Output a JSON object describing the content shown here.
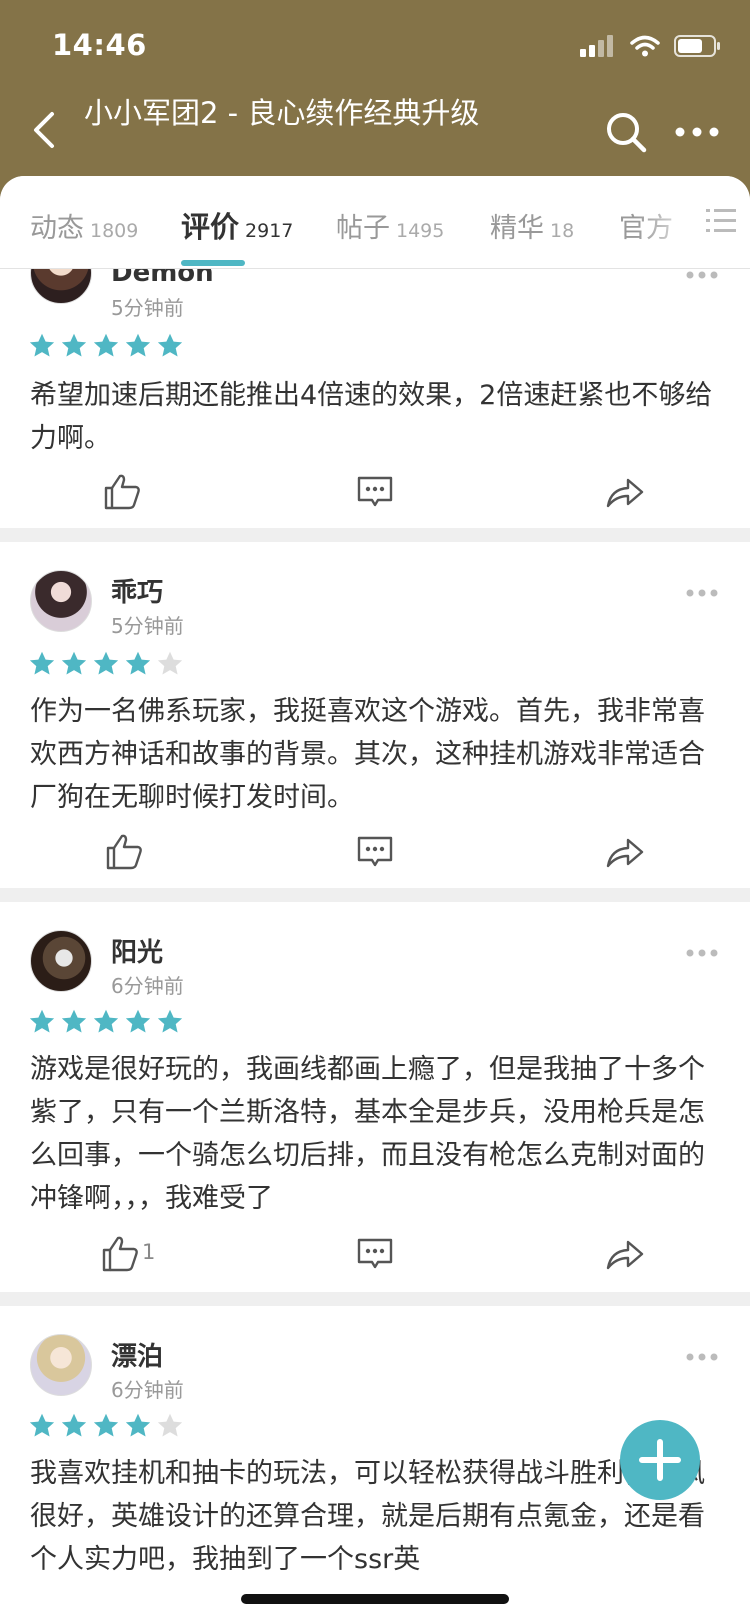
{
  "status_bar": {
    "time": "14:46"
  },
  "header": {
    "title": "小小军团2 - 良心续作经典升级"
  },
  "tabs": [
    {
      "label": "动态",
      "count": "1809"
    },
    {
      "label": "评价",
      "count": "2917"
    },
    {
      "label": "帖子",
      "count": "1495"
    },
    {
      "label": "精华",
      "count": "18"
    },
    {
      "label": "官方",
      "count": ""
    }
  ],
  "reviews": [
    {
      "user": "Demon",
      "time": "5分钟前",
      "rating": 5,
      "text": "希望加速后期还能推出4倍速的效果，2倍速赶紧也不够给力啊。",
      "likes": ""
    },
    {
      "user": "乖巧",
      "time": "5分钟前",
      "rating": 4,
      "text": "作为一名佛系玩家，我挺喜欢这个游戏。首先，我非常喜欢西方神话和故事的背景。其次，这种挂机游戏非常适合厂狗在无聊时候打发时间。",
      "likes": ""
    },
    {
      "user": "阳光",
      "time": "6分钟前",
      "rating": 5,
      "text": "游戏是很好玩的，我画线都画上瘾了，但是我抽了十多个紫了，只有一个兰斯洛特，基本全是步兵，没用枪兵是怎么回事，一个骑怎么切后排，而且没有枪怎么克制对面的冲锋啊，，，我难受了",
      "likes": "1"
    },
    {
      "user": "漂泊",
      "time": "6分钟前",
      "rating": 4,
      "text": "我喜欢挂机和抽卡的玩法，可以轻松获得战斗胜利，画风很好，英雄设计的还算合理，就是后期有点氪金，还是看个人实力吧，我抽到了一个ssr英",
      "likes": ""
    }
  ],
  "colors": {
    "header_bg": "#847348",
    "accent": "#4fb7c4",
    "star_empty": "#dddddd"
  },
  "icons": [
    "back-icon",
    "search-icon",
    "more-icon",
    "menu-icon",
    "like-icon",
    "comment-icon",
    "share-icon",
    "star-icon",
    "plus-icon"
  ]
}
